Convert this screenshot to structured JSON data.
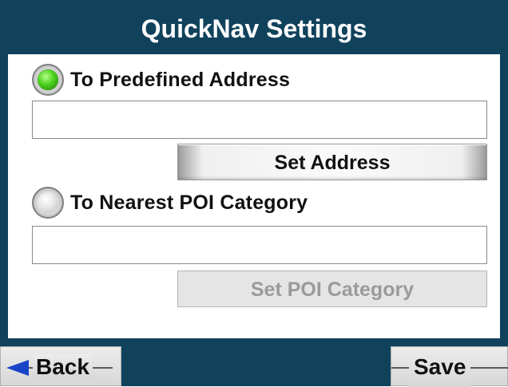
{
  "header": {
    "title": "QuickNav Settings"
  },
  "options": [
    {
      "label": "To Predefined Address",
      "selected": true,
      "field_value": "",
      "button_label": "Set Address",
      "button_enabled": true
    },
    {
      "label": "To Nearest POI Category",
      "selected": false,
      "field_value": "",
      "button_label": "Set POI Category",
      "button_enabled": false
    }
  ],
  "footer": {
    "back_label": "Back",
    "save_label": "Save"
  },
  "colors": {
    "frame": "#10425c",
    "radio_selected": "#4ccf1c",
    "back_arrow": "#1a44c8",
    "disabled_text": "#9a9a9a"
  },
  "icons": {
    "back": "left-arrow-icon"
  }
}
